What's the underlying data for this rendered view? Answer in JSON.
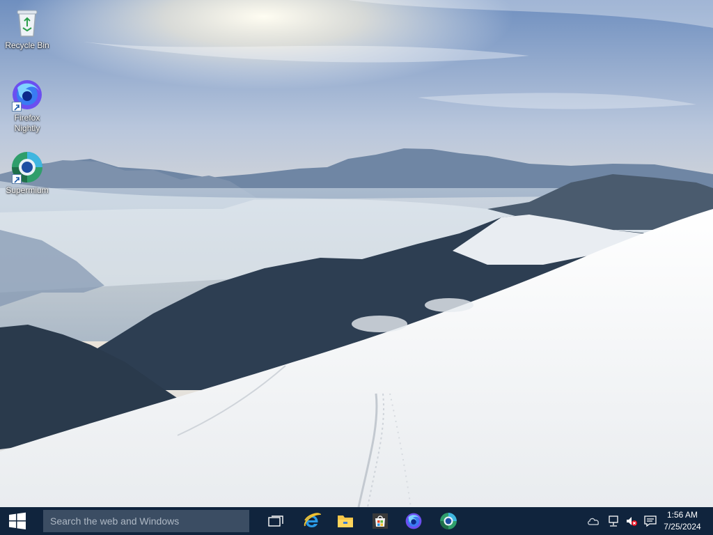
{
  "desktop": {
    "icons": [
      {
        "label": "Recycle Bin",
        "icon": "recycle-bin-icon"
      },
      {
        "label": "Firefox Nightly",
        "icon": "firefox-nightly-icon"
      },
      {
        "label": "Supermium",
        "icon": "supermium-icon"
      }
    ]
  },
  "taskbar": {
    "start_icon": "windows-logo-icon",
    "search_placeholder": "Search the web and Windows",
    "apps": [
      {
        "name": "Task View",
        "icon": "task-view-icon"
      },
      {
        "name": "Internet Explorer",
        "icon": "internet-explorer-icon"
      },
      {
        "name": "File Explorer",
        "icon": "file-explorer-icon"
      },
      {
        "name": "Store",
        "icon": "store-icon"
      },
      {
        "name": "Firefox Nightly",
        "icon": "firefox-nightly-icon"
      },
      {
        "name": "Supermium",
        "icon": "supermium-icon"
      }
    ],
    "tray": {
      "icons": [
        "onedrive-icon",
        "network-icon",
        "volume-muted-icon",
        "action-center-icon"
      ],
      "time": "1:56 AM",
      "date": "7/25/2024"
    },
    "background": "#10243d"
  }
}
